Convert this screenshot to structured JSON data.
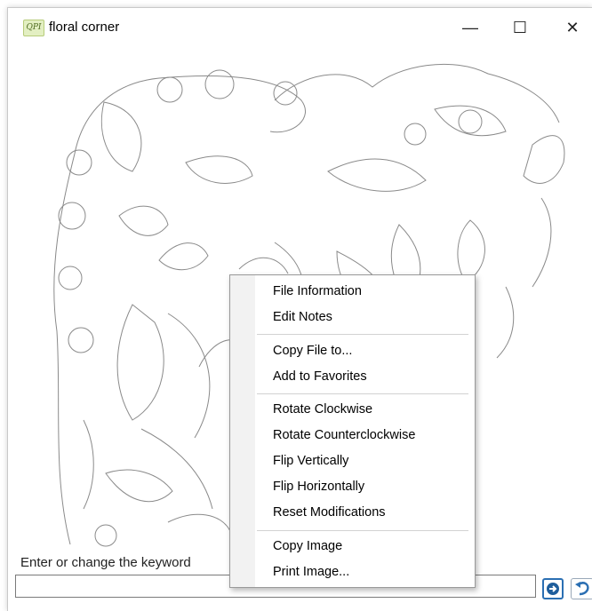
{
  "window": {
    "title": "floral corner",
    "app_icon_text": "QPI",
    "minimize": "—",
    "maximize": "☐",
    "close": "✕"
  },
  "keyword": {
    "label": "Enter or change the keyword",
    "value": ""
  },
  "context_menu": {
    "items": [
      "File Information",
      "Edit Notes",
      "Copy File to...",
      "Add to Favorites",
      "Rotate Clockwise",
      "Rotate Counterclockwise",
      "Flip Vertically",
      "Flip Horizontally",
      "Reset Modifications",
      "Copy Image",
      "Print Image..."
    ],
    "highlighted_item": "Edit Notes"
  },
  "colors": {
    "highlight": "#f7f25a",
    "accent": "#2b6fb3"
  },
  "icons": {
    "go": "go-arrow-icon",
    "undo": "undo-icon"
  }
}
